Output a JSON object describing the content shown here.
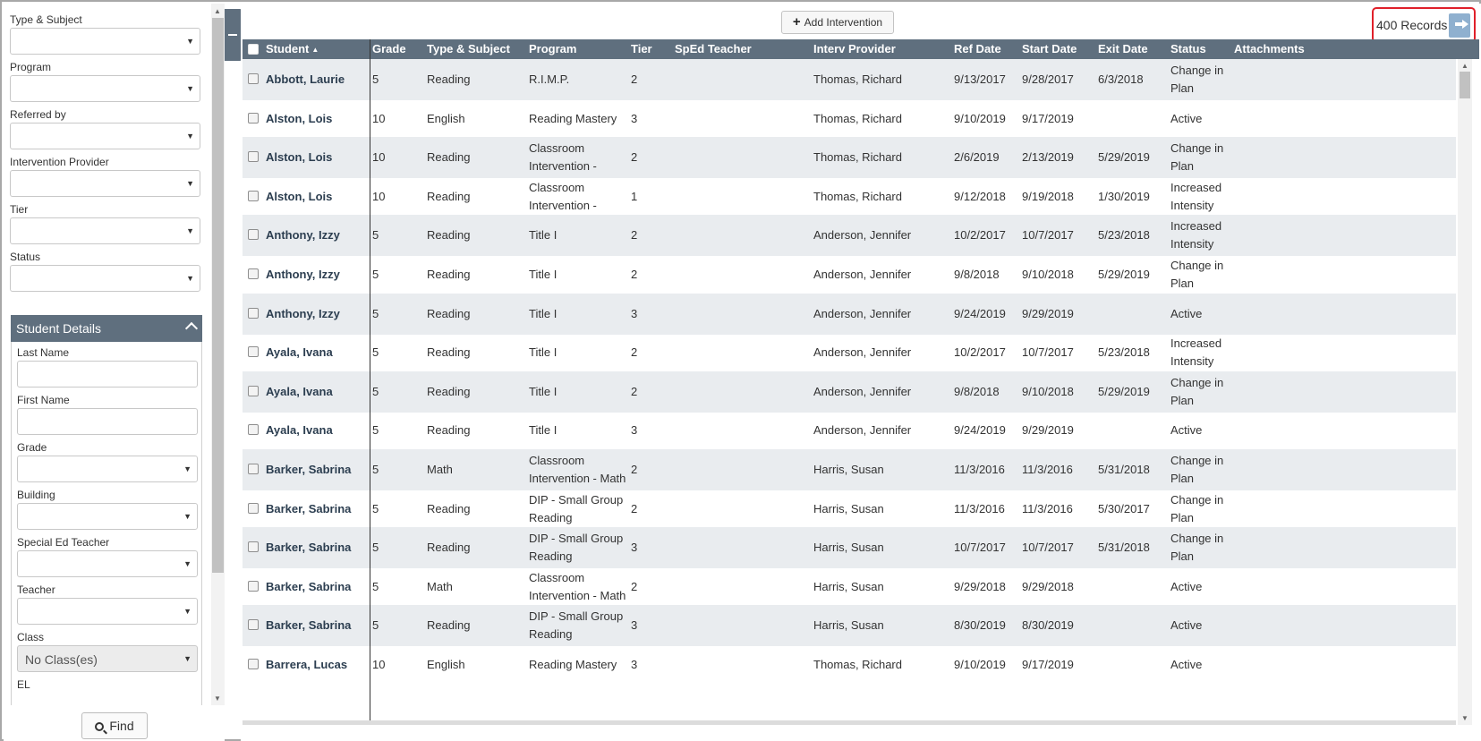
{
  "filters": {
    "type_subject": {
      "label": "Type & Subject",
      "value": ""
    },
    "program": {
      "label": "Program",
      "value": ""
    },
    "referred_by": {
      "label": "Referred by",
      "value": ""
    },
    "intervention_provider": {
      "label": "Intervention Provider",
      "value": ""
    },
    "tier": {
      "label": "Tier",
      "value": ""
    },
    "status": {
      "label": "Status",
      "value": ""
    }
  },
  "student_details": {
    "title": "Student Details",
    "last_name": {
      "label": "Last Name",
      "value": ""
    },
    "first_name": {
      "label": "First Name",
      "value": ""
    },
    "grade": {
      "label": "Grade",
      "value": ""
    },
    "building": {
      "label": "Building",
      "value": ""
    },
    "special_ed_teacher": {
      "label": "Special Ed Teacher",
      "value": ""
    },
    "teacher": {
      "label": "Teacher",
      "value": ""
    },
    "class": {
      "label": "Class",
      "value": "No Class(es)"
    },
    "el": {
      "label": "EL"
    }
  },
  "find_label": "Find",
  "toolbar": {
    "add_intervention": "Add Intervention",
    "records_count": "400 Records"
  },
  "icons": {
    "export": "export-icon",
    "search": "search-icon",
    "plus": "plus-icon",
    "collapse": "collapse-panel-icon",
    "chevron": "chevron-up-icon"
  },
  "colors": {
    "header_bg": "#5f6f7e",
    "highlight_border": "#e0202a",
    "alt_row": "#e9ecef"
  },
  "table": {
    "columns": {
      "student": "Student",
      "grade": "Grade",
      "type_subject": "Type & Subject",
      "program": "Program",
      "tier": "Tier",
      "sped_teacher": "SpEd Teacher",
      "interv_provider": "Interv Provider",
      "ref_date": "Ref Date",
      "start_date": "Start Date",
      "exit_date": "Exit Date",
      "status": "Status",
      "attachments": "Attachments"
    },
    "rows": [
      {
        "student": "Abbott, Laurie",
        "grade": "5",
        "type": "Reading",
        "program": "R.I.M.P.",
        "tier": "2",
        "sped": "",
        "provider": "Thomas, Richard",
        "ref": "9/13/2017",
        "start": "9/28/2017",
        "exit": "6/3/2018",
        "status": "Change in Plan",
        "attach": ""
      },
      {
        "student": "Alston, Lois",
        "grade": "10",
        "type": "English",
        "program": "Reading Mastery",
        "tier": "3",
        "sped": "",
        "provider": "Thomas, Richard",
        "ref": "9/10/2019",
        "start": "9/17/2019",
        "exit": "",
        "status": "Active",
        "attach": ""
      },
      {
        "student": "Alston, Lois",
        "grade": "10",
        "type": "Reading",
        "program": "Classroom Intervention -",
        "tier": "2",
        "sped": "",
        "provider": "Thomas, Richard",
        "ref": "2/6/2019",
        "start": "2/13/2019",
        "exit": "5/29/2019",
        "status": "Change in Plan",
        "attach": ""
      },
      {
        "student": "Alston, Lois",
        "grade": "10",
        "type": "Reading",
        "program": "Classroom Intervention -",
        "tier": "1",
        "sped": "",
        "provider": "Thomas, Richard",
        "ref": "9/12/2018",
        "start": "9/19/2018",
        "exit": "1/30/2019",
        "status": "Increased Intensity",
        "attach": ""
      },
      {
        "student": "Anthony, Izzy",
        "grade": "5",
        "type": "Reading",
        "program": "Title I",
        "tier": "2",
        "sped": "",
        "provider": "Anderson, Jennifer",
        "ref": "10/2/2017",
        "start": "10/7/2017",
        "exit": "5/23/2018",
        "status": "Increased Intensity",
        "attach": ""
      },
      {
        "student": "Anthony, Izzy",
        "grade": "5",
        "type": "Reading",
        "program": "Title I",
        "tier": "2",
        "sped": "",
        "provider": "Anderson, Jennifer",
        "ref": "9/8/2018",
        "start": "9/10/2018",
        "exit": "5/29/2019",
        "status": "Change in Plan",
        "attach": ""
      },
      {
        "student": "Anthony, Izzy",
        "grade": "5",
        "type": "Reading",
        "program": "Title I",
        "tier": "3",
        "sped": "",
        "provider": "Anderson, Jennifer",
        "ref": "9/24/2019",
        "start": "9/29/2019",
        "exit": "",
        "status": "Active",
        "attach": ""
      },
      {
        "student": "Ayala, Ivana",
        "grade": "5",
        "type": "Reading",
        "program": "Title I",
        "tier": "2",
        "sped": "",
        "provider": "Anderson, Jennifer",
        "ref": "10/2/2017",
        "start": "10/7/2017",
        "exit": "5/23/2018",
        "status": "Increased Intensity",
        "attach": ""
      },
      {
        "student": "Ayala, Ivana",
        "grade": "5",
        "type": "Reading",
        "program": "Title I",
        "tier": "2",
        "sped": "",
        "provider": "Anderson, Jennifer",
        "ref": "9/8/2018",
        "start": "9/10/2018",
        "exit": "5/29/2019",
        "status": "Change in Plan",
        "attach": ""
      },
      {
        "student": "Ayala, Ivana",
        "grade": "5",
        "type": "Reading",
        "program": "Title I",
        "tier": "3",
        "sped": "",
        "provider": "Anderson, Jennifer",
        "ref": "9/24/2019",
        "start": "9/29/2019",
        "exit": "",
        "status": "Active",
        "attach": ""
      },
      {
        "student": "Barker, Sabrina",
        "grade": "5",
        "type": "Math",
        "program": "Classroom Intervention - Math",
        "tier": "2",
        "sped": "",
        "provider": "Harris, Susan",
        "ref": "11/3/2016",
        "start": "11/3/2016",
        "exit": "5/31/2018",
        "status": "Change in Plan",
        "attach": ""
      },
      {
        "student": "Barker, Sabrina",
        "grade": "5",
        "type": "Reading",
        "program": "DIP - Small Group Reading",
        "tier": "2",
        "sped": "",
        "provider": "Harris, Susan",
        "ref": "11/3/2016",
        "start": "11/3/2016",
        "exit": "5/30/2017",
        "status": "Change in Plan",
        "attach": ""
      },
      {
        "student": "Barker, Sabrina",
        "grade": "5",
        "type": "Reading",
        "program": "DIP - Small Group Reading",
        "tier": "3",
        "sped": "",
        "provider": "Harris, Susan",
        "ref": "10/7/2017",
        "start": "10/7/2017",
        "exit": "5/31/2018",
        "status": "Change in Plan",
        "attach": ""
      },
      {
        "student": "Barker, Sabrina",
        "grade": "5",
        "type": "Math",
        "program": "Classroom Intervention - Math",
        "tier": "2",
        "sped": "",
        "provider": "Harris, Susan",
        "ref": "9/29/2018",
        "start": "9/29/2018",
        "exit": "",
        "status": "Active",
        "attach": ""
      },
      {
        "student": "Barker, Sabrina",
        "grade": "5",
        "type": "Reading",
        "program": "DIP - Small Group Reading",
        "tier": "3",
        "sped": "",
        "provider": "Harris, Susan",
        "ref": "8/30/2019",
        "start": "8/30/2019",
        "exit": "",
        "status": "Active",
        "attach": ""
      },
      {
        "student": "Barrera, Lucas",
        "grade": "10",
        "type": "English",
        "program": "Reading Mastery",
        "tier": "3",
        "sped": "",
        "provider": "Thomas, Richard",
        "ref": "9/10/2019",
        "start": "9/17/2019",
        "exit": "",
        "status": "Active",
        "attach": ""
      }
    ]
  }
}
